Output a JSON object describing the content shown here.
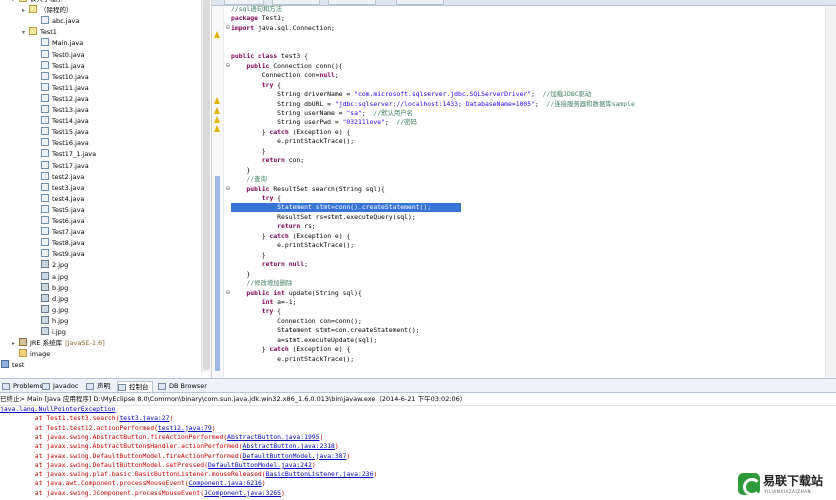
{
  "explorer": {
    "items": [
      {
        "label": "公共子程序",
        "kind": "pkg",
        "indent": 0,
        "arrow": "▸"
      },
      {
        "label": "（除程的）",
        "kind": "pkg",
        "indent": 1,
        "arrow": "▸"
      },
      {
        "label": "abc.java",
        "kind": "java",
        "indent": 2,
        "arrow": ""
      },
      {
        "label": "Test1",
        "kind": "pkg",
        "indent": 1,
        "arrow": "▾"
      },
      {
        "label": "Main.java",
        "kind": "java",
        "indent": 2,
        "arrow": ""
      },
      {
        "label": "Test0.java",
        "kind": "java",
        "indent": 2,
        "arrow": ""
      },
      {
        "label": "Test1.java",
        "kind": "java",
        "indent": 2,
        "arrow": ""
      },
      {
        "label": "Test10.java",
        "kind": "java",
        "indent": 2,
        "arrow": ""
      },
      {
        "label": "Test11.java",
        "kind": "java",
        "indent": 2,
        "arrow": ""
      },
      {
        "label": "Test12.java",
        "kind": "java",
        "indent": 2,
        "arrow": ""
      },
      {
        "label": "Test13.java",
        "kind": "java",
        "indent": 2,
        "arrow": ""
      },
      {
        "label": "Test14.java",
        "kind": "java",
        "indent": 2,
        "arrow": ""
      },
      {
        "label": "Test15.java",
        "kind": "java",
        "indent": 2,
        "arrow": ""
      },
      {
        "label": "Test16.java",
        "kind": "java",
        "indent": 2,
        "arrow": ""
      },
      {
        "label": "Test17_1.java",
        "kind": "java",
        "indent": 2,
        "arrow": ""
      },
      {
        "label": "Test17.java",
        "kind": "java",
        "indent": 2,
        "arrow": ""
      },
      {
        "label": "test2.java",
        "kind": "java",
        "indent": 2,
        "arrow": ""
      },
      {
        "label": "test3.java",
        "kind": "java",
        "indent": 2,
        "arrow": ""
      },
      {
        "label": "test4.java",
        "kind": "java",
        "indent": 2,
        "arrow": ""
      },
      {
        "label": "Test5.java",
        "kind": "java",
        "indent": 2,
        "arrow": ""
      },
      {
        "label": "Test6.java",
        "kind": "java",
        "indent": 2,
        "arrow": ""
      },
      {
        "label": "Test7.java",
        "kind": "java",
        "indent": 2,
        "arrow": ""
      },
      {
        "label": "Test8.java",
        "kind": "java",
        "indent": 2,
        "arrow": ""
      },
      {
        "label": "Test9.java",
        "kind": "java",
        "indent": 2,
        "arrow": ""
      },
      {
        "label": "2.jpg",
        "kind": "img",
        "indent": 2,
        "arrow": ""
      },
      {
        "label": "a.jpg",
        "kind": "img",
        "indent": 2,
        "arrow": ""
      },
      {
        "label": "b.jpg",
        "kind": "img",
        "indent": 2,
        "arrow": ""
      },
      {
        "label": "d.jpg",
        "kind": "img",
        "indent": 2,
        "arrow": ""
      },
      {
        "label": "g.jpg",
        "kind": "img",
        "indent": 2,
        "arrow": ""
      },
      {
        "label": "h.jpg",
        "kind": "img",
        "indent": 2,
        "arrow": ""
      },
      {
        "label": "i.jpg",
        "kind": "img",
        "indent": 2,
        "arrow": ""
      },
      {
        "label": "JRE 系统库",
        "suffix": "[JavaSE-1.6]",
        "kind": "lib",
        "indent": 0,
        "arrow": "▸"
      },
      {
        "label": "image",
        "kind": "folder",
        "indent": 0,
        "arrow": ""
      },
      {
        "label": "test",
        "kind": "proj",
        "indent": -1,
        "arrow": "▸"
      }
    ]
  },
  "editor": {
    "lines": [
      [
        {
          "t": "//sql语句和方法",
          "c": "cm"
        }
      ],
      [
        {
          "t": "package ",
          "c": "kw"
        },
        {
          "t": "Test1;",
          "c": ""
        }
      ],
      [
        {
          "t": "import ",
          "c": "kw"
        },
        {
          "t": "java.sql.Connection;",
          "c": ""
        }
      ],
      [],
      [],
      [
        {
          "t": "public class ",
          "c": "kw"
        },
        {
          "t": "test3 {",
          "c": ""
        }
      ],
      [
        {
          "t": "    public ",
          "c": "kw"
        },
        {
          "t": "Connection conn(){",
          "c": ""
        }
      ],
      [
        {
          "t": "        Connection con=",
          "c": ""
        },
        {
          "t": "null",
          "c": "kw"
        },
        {
          "t": ";",
          "c": ""
        }
      ],
      [
        {
          "t": "        try ",
          "c": "kw"
        },
        {
          "t": "{",
          "c": ""
        }
      ],
      [
        {
          "t": "            String driverName = ",
          "c": ""
        },
        {
          "t": "\"com.microsoft.sqlserver.jdbc.SQLServerDriver\"",
          "c": "str"
        },
        {
          "t": ";  ",
          "c": ""
        },
        {
          "t": "//加载JDBC驱动",
          "c": "cm"
        }
      ],
      [
        {
          "t": "            String dbURL = ",
          "c": ""
        },
        {
          "t": "\"jdbc:sqlserver://localhost:1433; DatabaseName=1005\"",
          "c": "str"
        },
        {
          "t": ";  ",
          "c": ""
        },
        {
          "t": "//连接服务器和数据库sample",
          "c": "cm"
        }
      ],
      [
        {
          "t": "            String userName = ",
          "c": ""
        },
        {
          "t": "\"sa\"",
          "c": "str"
        },
        {
          "t": ";  ",
          "c": ""
        },
        {
          "t": "//默认用户名",
          "c": "cm"
        }
      ],
      [
        {
          "t": "            String userPwd = ",
          "c": ""
        },
        {
          "t": "\"03211love\"",
          "c": "str"
        },
        {
          "t": ";  ",
          "c": ""
        },
        {
          "t": "//密码",
          "c": "cm"
        }
      ],
      [
        {
          "t": "        } ",
          "c": ""
        },
        {
          "t": "catch ",
          "c": "kw"
        },
        {
          "t": "(Exception e) {",
          "c": ""
        }
      ],
      [
        {
          "t": "            e.printStackTrace();",
          "c": ""
        }
      ],
      [
        {
          "t": "        }",
          "c": ""
        }
      ],
      [
        {
          "t": "        return ",
          "c": "kw"
        },
        {
          "t": "con;",
          "c": ""
        }
      ],
      [
        {
          "t": "    }",
          "c": ""
        }
      ],
      [
        {
          "t": "    //查询",
          "c": "cm"
        }
      ],
      [
        {
          "t": "    public ",
          "c": "kw"
        },
        {
          "t": "ResultSet search(String sql){",
          "c": ""
        }
      ],
      [
        {
          "t": "        try ",
          "c": "kw"
        },
        {
          "t": "{",
          "c": ""
        }
      ],
      [
        {
          "t": "            Statement stmt=conn().createStatement();",
          "c": ""
        }
      ],
      [
        {
          "t": "            ResultSet rs=stmt.executeQuery(sql);",
          "c": ""
        }
      ],
      [
        {
          "t": "            return ",
          "c": "kw"
        },
        {
          "t": "rs;",
          "c": ""
        }
      ],
      [
        {
          "t": "        } ",
          "c": ""
        },
        {
          "t": "catch ",
          "c": "kw"
        },
        {
          "t": "(Exception e) {",
          "c": ""
        }
      ],
      [
        {
          "t": "            e.printStackTrace();",
          "c": ""
        }
      ],
      [
        {
          "t": "        }",
          "c": ""
        }
      ],
      [
        {
          "t": "        return ",
          "c": "kw"
        },
        {
          "t": "null",
          "c": "kw"
        },
        {
          "t": ";",
          "c": ""
        }
      ],
      [
        {
          "t": "    }",
          "c": ""
        }
      ],
      [
        {
          "t": "    //修改增加删除",
          "c": "cm"
        }
      ],
      [
        {
          "t": "    public int ",
          "c": "kw"
        },
        {
          "t": "update(String sql){",
          "c": ""
        }
      ],
      [
        {
          "t": "        int ",
          "c": "kw"
        },
        {
          "t": "a=-1;",
          "c": ""
        }
      ],
      [
        {
          "t": "        try ",
          "c": "kw"
        },
        {
          "t": "{",
          "c": ""
        }
      ],
      [
        {
          "t": "            Connection con=conn();",
          "c": ""
        }
      ],
      [
        {
          "t": "            Statement stmt=con.createStatement();",
          "c": ""
        }
      ],
      [
        {
          "t": "            a=stmt.executeUpdate(sql);",
          "c": ""
        }
      ],
      [
        {
          "t": "        } ",
          "c": ""
        },
        {
          "t": "catch ",
          "c": "kw"
        },
        {
          "t": "(Exception e) {",
          "c": ""
        }
      ],
      [
        {
          "t": "            e.printStackTrace();",
          "c": ""
        }
      ]
    ]
  },
  "bottom_tabs": [
    {
      "label": "Problems",
      "active": false
    },
    {
      "label": "Javadoc",
      "active": false
    },
    {
      "label": "声明",
      "active": false
    },
    {
      "label": "控制台",
      "active": true
    },
    {
      "label": "DB Browser",
      "active": false
    }
  ],
  "console": {
    "header": "已终止> Main [Java 应用程序] D:\\MyEclipse 8.0\\Common\\binary\\com.sun.java.jdk.win32.x86_1.6.0.013\\bin\\javaw.exe（2014-6-21 下午03:02:06）",
    "lines": [
      {
        "pre": "java.lang.NullPointerException",
        "link": "",
        "post": "",
        "indent": false,
        "link_style": true
      },
      {
        "pre": "\tat Test1.test3.search(",
        "link": "test3.java:27",
        "post": ")",
        "indent": true
      },
      {
        "pre": "\tat Test1.test12.actionPerformed(",
        "link": "test12.java:79",
        "post": ")",
        "indent": true
      },
      {
        "pre": "\tat javax.swing.AbstractButton.fireActionPerformed(",
        "link": "AbstractButton.java:1995",
        "post": ")",
        "indent": true
      },
      {
        "pre": "\tat javax.swing.AbstractButton$Handler.actionPerformed(",
        "link": "AbstractButton.java:2318",
        "post": ")",
        "indent": true
      },
      {
        "pre": "\tat javax.swing.DefaultButtonModel.fireActionPerformed(",
        "link": "DefaultButtonModel.java:387",
        "post": ")",
        "indent": true
      },
      {
        "pre": "\tat javax.swing.DefaultButtonModel.setPressed(",
        "link": "DefaultButtonModel.java:242",
        "post": ")",
        "indent": true
      },
      {
        "pre": "\tat javax.swing.plaf.basic.BasicButtonListener.mouseReleased(",
        "link": "BasicButtonListener.java:236",
        "post": ")",
        "indent": true
      },
      {
        "pre": "\tat java.awt.Component.processMouseEvent(",
        "link": "Component.java:6216",
        "post": ")",
        "indent": true
      },
      {
        "pre": "\tat javax.swing.JComponent.processMouseEvent(",
        "link": "JComponent.java:3265",
        "post": ")",
        "indent": true
      }
    ]
  },
  "watermark": {
    "title": "易联下载站",
    "subtitle": "YILIANXIAZAIZHAN"
  }
}
